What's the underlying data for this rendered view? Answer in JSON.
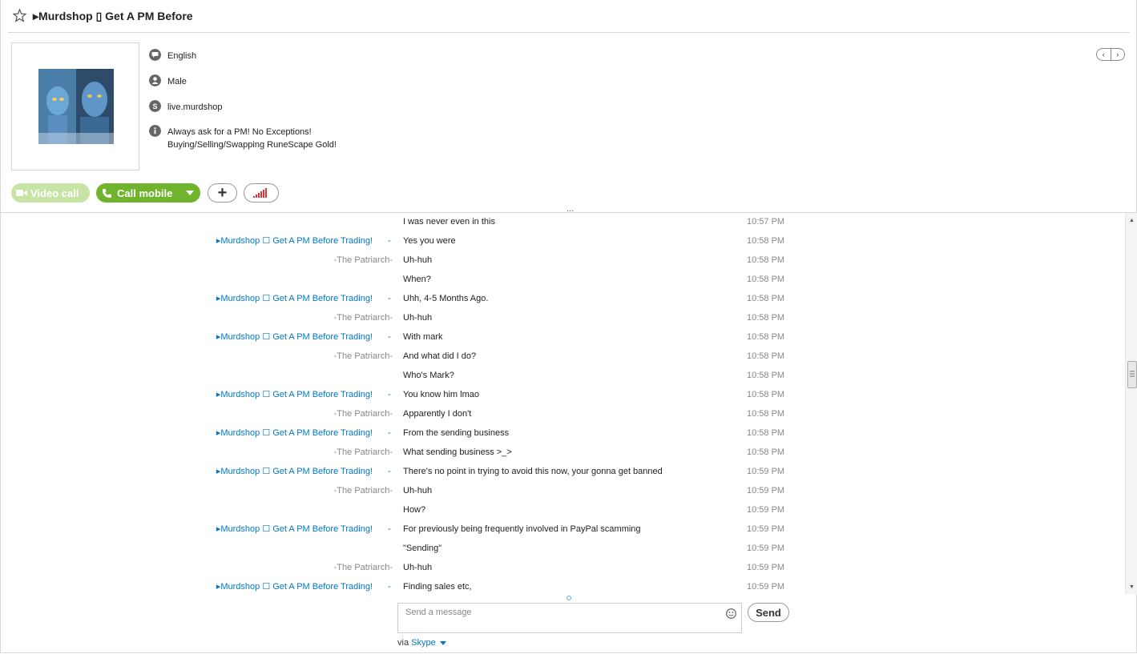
{
  "header": {
    "title": "▸Murdshop ▯ Get A PM Before"
  },
  "profile": {
    "language": "English",
    "gender": "Male",
    "skype_name": "live.murdshop",
    "mood_line1": "Always ask for a PM! No Exceptions!",
    "mood_line2": "Buying/Selling/Swapping RuneScape Gold!"
  },
  "nav": {
    "prev": "‹",
    "next": "›"
  },
  "actions": {
    "video_call": "Video call",
    "call_mobile": "Call mobile",
    "add": "+",
    "more_dots": "..."
  },
  "messages": [
    {
      "sender": "",
      "text": "I was never even in this",
      "time": "10:57 PM",
      "self": false
    },
    {
      "sender": "▸Murdshop ☐ Get A PM Before Trading!",
      "text": "Yes you were",
      "time": "10:58 PM",
      "self": true
    },
    {
      "sender": "-The Patriarch-",
      "text": "Uh-huh",
      "time": "10:58 PM",
      "self": false
    },
    {
      "sender": "",
      "text": "When?",
      "time": "10:58 PM",
      "self": false
    },
    {
      "sender": "▸Murdshop ☐ Get A PM Before Trading!",
      "text": "Uhh, 4-5 Months Ago.",
      "time": "10:58 PM",
      "self": true
    },
    {
      "sender": "-The Patriarch-",
      "text": "Uh-huh",
      "time": "10:58 PM",
      "self": false
    },
    {
      "sender": "▸Murdshop ☐ Get A PM Before Trading!",
      "text": "With mark",
      "time": "10:58 PM",
      "self": true
    },
    {
      "sender": "-The Patriarch-",
      "text": "And what did I do?",
      "time": "10:58 PM",
      "self": false
    },
    {
      "sender": "",
      "text": "Who's Mark?",
      "time": "10:58 PM",
      "self": false
    },
    {
      "sender": "▸Murdshop ☐ Get A PM Before Trading!",
      "text": "You know him lmao",
      "time": "10:58 PM",
      "self": true
    },
    {
      "sender": "-The Patriarch-",
      "text": "Apparently I don't",
      "time": "10:58 PM",
      "self": false
    },
    {
      "sender": "▸Murdshop ☐ Get A PM Before Trading!",
      "text": "From the sending business",
      "time": "10:58 PM",
      "self": true
    },
    {
      "sender": "-The Patriarch-",
      "text": "What sending business >_>",
      "time": "10:58 PM",
      "self": false
    },
    {
      "sender": "▸Murdshop ☐ Get A PM Before Trading!",
      "text": "There's no point in trying to avoid this now, your gonna get banned",
      "time": "10:59 PM",
      "self": true
    },
    {
      "sender": "-The Patriarch-",
      "text": "Uh-huh",
      "time": "10:59 PM",
      "self": false
    },
    {
      "sender": "",
      "text": "How?",
      "time": "10:59 PM",
      "self": false
    },
    {
      "sender": "▸Murdshop ☐ Get A PM Before Trading!",
      "text": "For previously being frequently involved in PayPal scamming",
      "time": "10:59 PM",
      "self": true
    },
    {
      "sender": "",
      "text": "\"Sending\"",
      "time": "10:59 PM",
      "self": true
    },
    {
      "sender": "-The Patriarch-",
      "text": "Uh-huh",
      "time": "10:59 PM",
      "self": false
    },
    {
      "sender": "▸Murdshop ☐ Get A PM Before Trading!",
      "text": "Finding sales etc,",
      "time": "10:59 PM",
      "self": true
    }
  ],
  "compose": {
    "placeholder": "Send a message",
    "send_label": "Send",
    "via_prefix": "via",
    "via_service": "Skype"
  },
  "colors": {
    "accent": "#0078c2",
    "call_green": "#6fb42c",
    "video_green_disabled": "#c8e3a6"
  }
}
